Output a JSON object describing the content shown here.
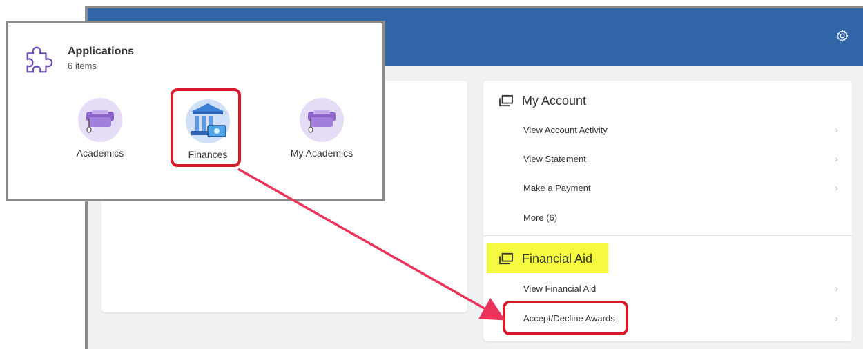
{
  "header": {
    "settings_icon": "gear-icon"
  },
  "applications": {
    "title": "Applications",
    "count": "6 items",
    "items": [
      {
        "label": "Academics",
        "icon": "graduation-cap-icon"
      },
      {
        "label": "Finances",
        "icon": "bank-icon"
      },
      {
        "label": "My Academics",
        "icon": "graduation-cap-icon"
      }
    ]
  },
  "my_account": {
    "title": "My Account",
    "links": [
      {
        "label": "View Account Activity"
      },
      {
        "label": "View Statement"
      },
      {
        "label": "Make a Payment"
      },
      {
        "label": "More (6)"
      }
    ]
  },
  "financial_aid": {
    "title": "Financial Aid",
    "links": [
      {
        "label": "View Financial Aid"
      },
      {
        "label": "Accept/Decline Awards"
      }
    ]
  },
  "colors": {
    "header_blue": "#3166a9",
    "highlight_yellow": "#f2f700",
    "callout_red": "#d71a2b",
    "arrow_pink": "#e8345a"
  }
}
